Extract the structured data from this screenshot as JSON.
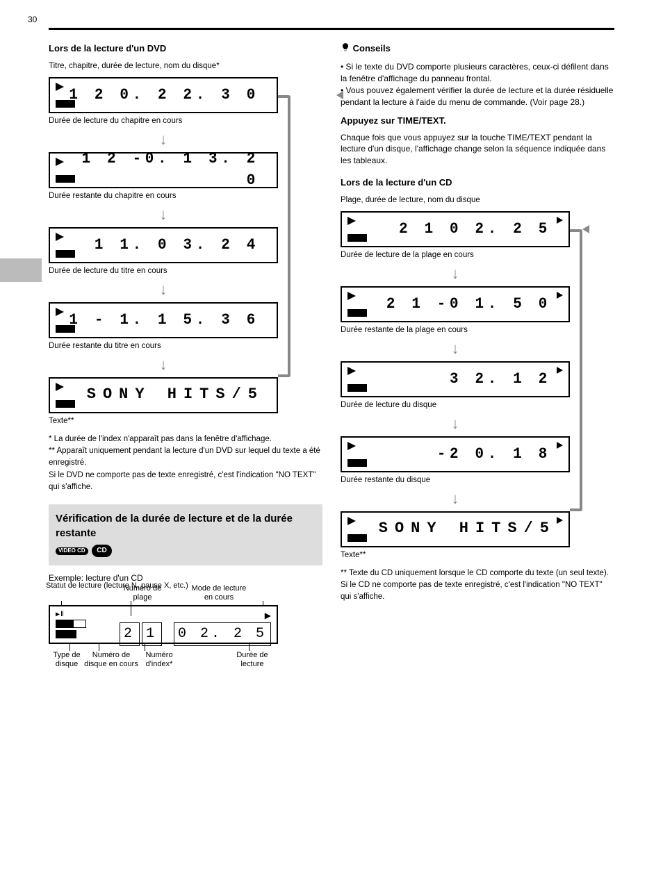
{
  "page_number": "30",
  "left": {
    "heading": "Lors de la lecture d'un DVD",
    "intro": "Titre, chapitre, durée de lecture, nom du disque*",
    "lcds": [
      {
        "digits": "1   2      0. 2 2. 3 0"
      },
      {
        "digits": "1   2    -0. 1 3. 2 0"
      },
      {
        "digits": "1           1. 0 3. 2 4"
      },
      {
        "digits": "1         - 1. 1 5. 3 6"
      }
    ],
    "lcd_text": "SONY HITS/5",
    "captions": [
      "Durée de lecture du chapitre en cours",
      "Durée restante du chapitre en cours",
      "Durée de lecture du titre en cours",
      "Durée restante du titre en cours",
      "Texte**"
    ],
    "footnotes": "*  La durée de l'index n'apparaît pas dans la fenêtre d'affichage.\n** Apparaît uniquement pendant la lecture d'un DVD sur lequel du texte a été enregistré.\nSi le DVD ne comporte pas de texte enregistré, c'est l'indication \"NO TEXT\" qui s'affiche.",
    "gray": {
      "title": "Vérification de la durée de lecture et de la durée restante",
      "badge_video": "VIDEO CD",
      "badge_cd": "CD"
    },
    "example_note": "Exemple: lecture d'un CD",
    "diagram": {
      "digits_track": "2 1",
      "digits_time": "0 2. 2 5",
      "label_status": "Statut de lecture (lecture N, pause X, etc.)",
      "label_disctype": "Type de disque",
      "label_current": "Numéro de disque en cours",
      "label_track": "Numéro de plage",
      "label_index": "Numéro d'index*",
      "label_playmode": "Mode de lecture en cours",
      "label_playtime": "Durée de lecture"
    }
  },
  "right": {
    "tip_label": "Conseils",
    "tip_body": "• Si le texte du DVD comporte plusieurs caractères, ceux-ci défilent dans la fenêtre d'affichage du panneau frontal.\n• Vous pouvez également vérifier la durée de lecture et la durée résiduelle pendant la lecture à l'aide du menu de commande. (Voir page 28.)",
    "subheading": "Appuyez sur TIME/TEXT.",
    "sub_body": "Chaque fois que vous appuyez sur la touche TIME/TEXT pendant la lecture d'un disque, l'affichage change selon la séquence indiquée dans les tableaux.",
    "cd_heading": "Lors de la lecture d'un CD",
    "cd_intro": "Plage, durée de lecture, nom du disque",
    "lcds": [
      {
        "digits": "2 1              0 2. 2 5"
      },
      {
        "digits": "2 1            -0 1. 5 0"
      },
      {
        "digits": "                   3 2. 1 2"
      },
      {
        "digits": "                 -2 0. 1 8"
      }
    ],
    "lcd_text": "SONY HITS/5",
    "captions": [
      "Durée de lecture de la plage en cours",
      "Durée restante de la plage en cours",
      "Durée de lecture du disque",
      "Durée restante du disque",
      "Texte**"
    ],
    "footnote": "** Texte du CD uniquement lorsque le CD comporte du texte (un seul texte). Si le CD ne comporte pas de texte enregistré, c'est l'indication \"NO TEXT\" qui s'affiche."
  }
}
